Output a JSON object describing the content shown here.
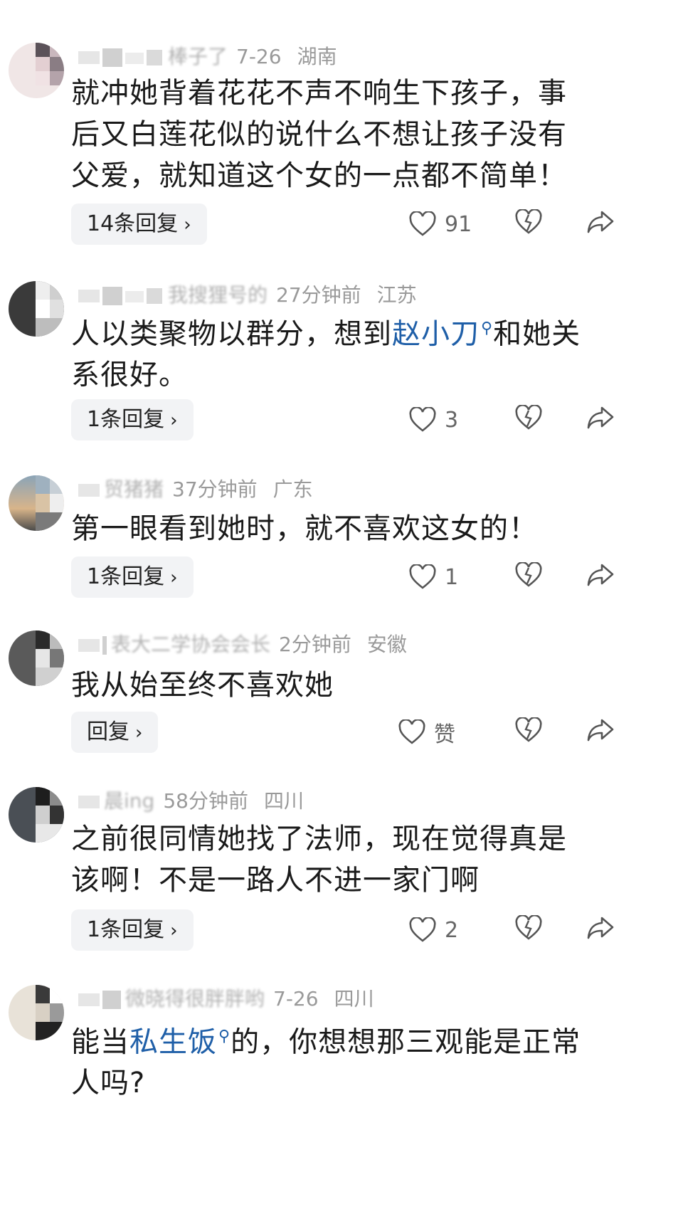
{
  "comments": [
    {
      "name": "棒子了",
      "time": "7-26",
      "location": "湖南",
      "text": "就冲她背着花花不声不响生下孩子，事后又白莲花似的说什么不想让孩子没有父爱，就知道这个女的一点都不简单！",
      "reply_label": "14条回复",
      "like_count": "91"
    },
    {
      "name": "我搜狸号的",
      "time": "27分钟前",
      "location": "江苏",
      "text_before": "人以类聚物以群分，想到",
      "link_text": "赵小刀",
      "text_after": "和她关系很好。",
      "reply_label": "1条回复",
      "like_count": "3"
    },
    {
      "name": "贸猪猪",
      "time": "37分钟前",
      "location": "广东",
      "text": "第一眼看到她时，就不喜欢这女的！",
      "reply_label": "1条回复",
      "like_count": "1"
    },
    {
      "name": "表大二学协会会长",
      "time": "2分钟前",
      "location": "安徽",
      "text": "我从始至终不喜欢她",
      "reply_label": "回复",
      "like_count": "赞"
    },
    {
      "name": "晨ing",
      "time": "58分钟前",
      "location": "四川",
      "text": "之前很同情她找了法师，现在觉得真是该啊！不是一路人不进一家门啊",
      "reply_label": "1条回复",
      "like_count": "2"
    },
    {
      "name": "微晓得很胖胖哟",
      "time": "7-26",
      "location": "四川",
      "text_before": "能当",
      "link_text": "私生饭",
      "text_after": "的，你想想那三观能是正常人吗?"
    }
  ],
  "icons": {
    "like": "heart-outline-icon",
    "dislike": "broken-heart-icon",
    "share": "share-arrow-icon",
    "search_link": "search-icon"
  },
  "colors": {
    "link": "#1f5fa8",
    "meta": "#9a9a9a",
    "button_bg": "#f2f3f5"
  }
}
